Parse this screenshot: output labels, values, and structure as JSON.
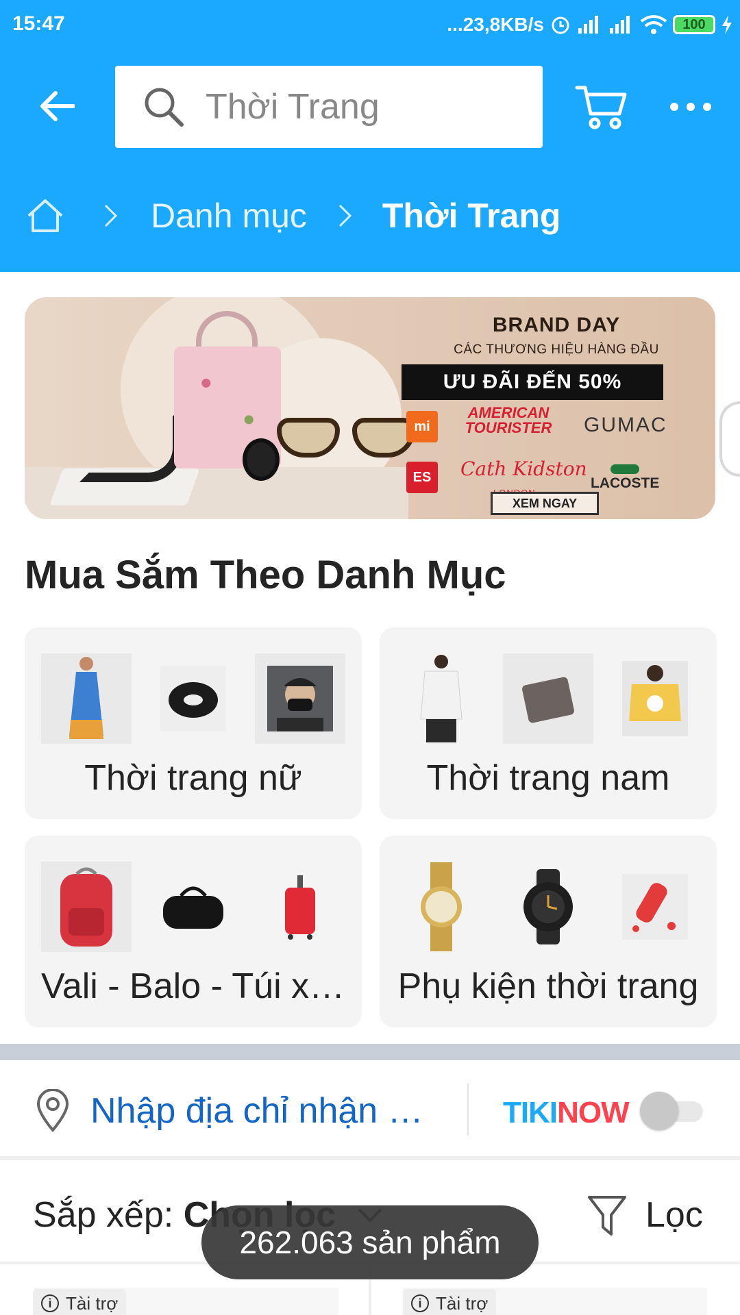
{
  "status_bar": {
    "time": "15:47",
    "net_speed": "...23,8KB/s",
    "battery": "100"
  },
  "search": {
    "placeholder": "Thời Trang"
  },
  "breadcrumb": {
    "items": [
      "Danh mục"
    ],
    "current": "Thời Trang"
  },
  "banner": {
    "title": "BRAND DAY",
    "subtitle": "CÁC THƯƠNG HIỆU HÀNG ĐẦU",
    "promo": "ƯU ĐÃI ĐẾN 50%",
    "brands": [
      "mi",
      "AMERICAN TOURISTER",
      "GUMAC",
      "ES",
      "Cath Kidston",
      "LACOSTE"
    ],
    "brand_sub_ck": "LONDON",
    "cta": "XEM NGAY"
  },
  "categories": {
    "title": "Mua Sắm Theo Danh Mục",
    "items": [
      {
        "label": "Thời trang nữ"
      },
      {
        "label": "Thời trang nam"
      },
      {
        "label": "Vali - Balo - Túi xách"
      },
      {
        "label": "Phụ kiện thời trang"
      }
    ]
  },
  "address": {
    "placeholder": "Nhập địa chỉ nhận hàng",
    "tikinow_a": "TIKI",
    "tikinow_b": "NOW",
    "tikinow_enabled": false
  },
  "sort": {
    "label": "Sắp xếp:",
    "value": "Chọn lọc",
    "filter_label": "Lọc"
  },
  "results": {
    "count_text": "262.063 sản phẩm"
  },
  "products": [
    {
      "badge": "Tài trợ"
    },
    {
      "badge": "Tài trợ"
    }
  ],
  "colors": {
    "header_bg": "#1ba8ff",
    "link_blue": "#1466c6",
    "tikinow_red": "#ff424e",
    "card_bg": "#f4f4f4"
  },
  "icons": [
    "back-arrow-icon",
    "search-icon",
    "cart-icon",
    "more-icon",
    "home-icon",
    "chevron-right-icon",
    "location-pin-icon",
    "chevron-down-icon",
    "filter-icon",
    "info-icon"
  ]
}
